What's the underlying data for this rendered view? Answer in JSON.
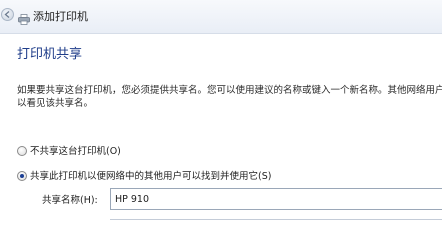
{
  "window": {
    "title": "添加打印机",
    "back_icon": "back-arrow-icon",
    "app_icon": "printer-icon"
  },
  "page": {
    "heading": "打印机共享",
    "description_lines": [
      "如果要共享这台打印机，您必须提供共享名。您可以使用建议的名称或键入一个新名称。其他网络用户",
      "以看见该共享名。"
    ]
  },
  "options": {
    "no_share_label": "不共享这台打印机(O)",
    "share_label": "共享此打印机以便网络中的其他用户可以找到并使用它(S)",
    "selected": "share"
  },
  "share_name": {
    "label": "共享名称(H):",
    "value": "HP 910"
  },
  "colors": {
    "heading": "#1f3d8a",
    "radio_dot": "#1c3f94"
  }
}
